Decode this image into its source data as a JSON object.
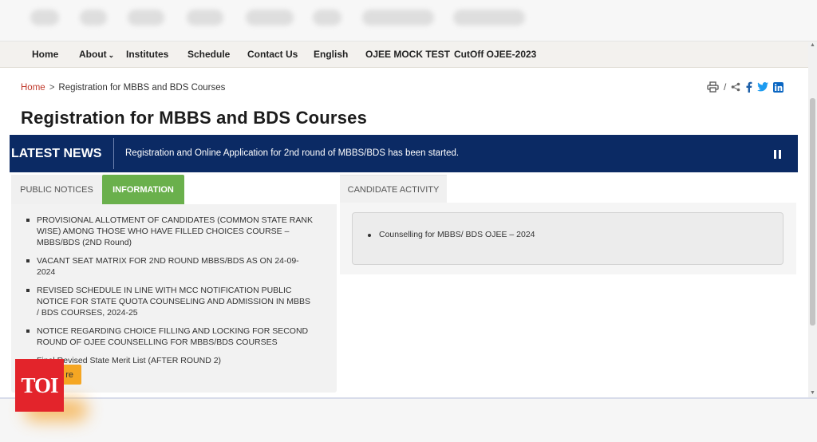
{
  "nav": {
    "items": [
      {
        "label": "Home"
      },
      {
        "label": "About"
      },
      {
        "label": "Institutes"
      },
      {
        "label": "Schedule"
      },
      {
        "label": "Contact Us"
      },
      {
        "label": "English"
      },
      {
        "label": "OJEE MOCK TEST"
      },
      {
        "label": "CutOff OJEE-2023"
      }
    ]
  },
  "breadcrumb": {
    "home": "Home",
    "separator": ">",
    "current": "Registration for MBBS and BDS Courses"
  },
  "share": {
    "divider": "/",
    "icons": [
      "print-icon",
      "share-icon",
      "facebook-icon",
      "twitter-icon",
      "linkedin-icon"
    ]
  },
  "page_title": "Registration for MBBS and BDS Courses",
  "latest_news": {
    "label": "LATEST NEWS",
    "text": "Registration and Online Application for 2nd round of MBBS/BDS has been started.",
    "colors": {
      "background": "#0b2a64",
      "text": "#ffffff"
    }
  },
  "left_tabs": [
    {
      "label": "PUBLIC NOTICES",
      "active": false
    },
    {
      "label": "INFORMATION",
      "active": true
    }
  ],
  "notices": [
    "PROVISIONAL ALLOTMENT OF CANDIDATES (COMMON STATE RANK WISE) AMONG THOSE WHO HAVE FILLED CHOICES COURSE – MBBS/BDS (2ND Round)",
    "VACANT SEAT MATRIX FOR 2ND ROUND MBBS/BDS AS ON 24-09-2024",
    "REVISED SCHEDULE IN LINE WITH MCC NOTIFICATION PUBLIC NOTICE FOR STATE QUOTA COUNSELING AND ADMISSION IN MBBS / BDS COURSES, 2024-25",
    "NOTICE REGARDING CHOICE FILLING AND LOCKING FOR SECOND ROUND OF OJEE COUNSELLING FOR MBBS/BDS COURSES",
    "Final Revised State Merit List (AFTER ROUND 2)"
  ],
  "read_more_label": "re",
  "right_tab": {
    "label": "CANDIDATE ACTIVITY"
  },
  "candidate_activity": [
    "Counselling for MBBS/ BDS OJEE – 2024"
  ],
  "watermark": {
    "text": "TOI",
    "color": "#e3242b"
  },
  "colors": {
    "accent_green": "#6ab04c",
    "read_more": "#f5a623",
    "link_red": "#c0392b"
  }
}
